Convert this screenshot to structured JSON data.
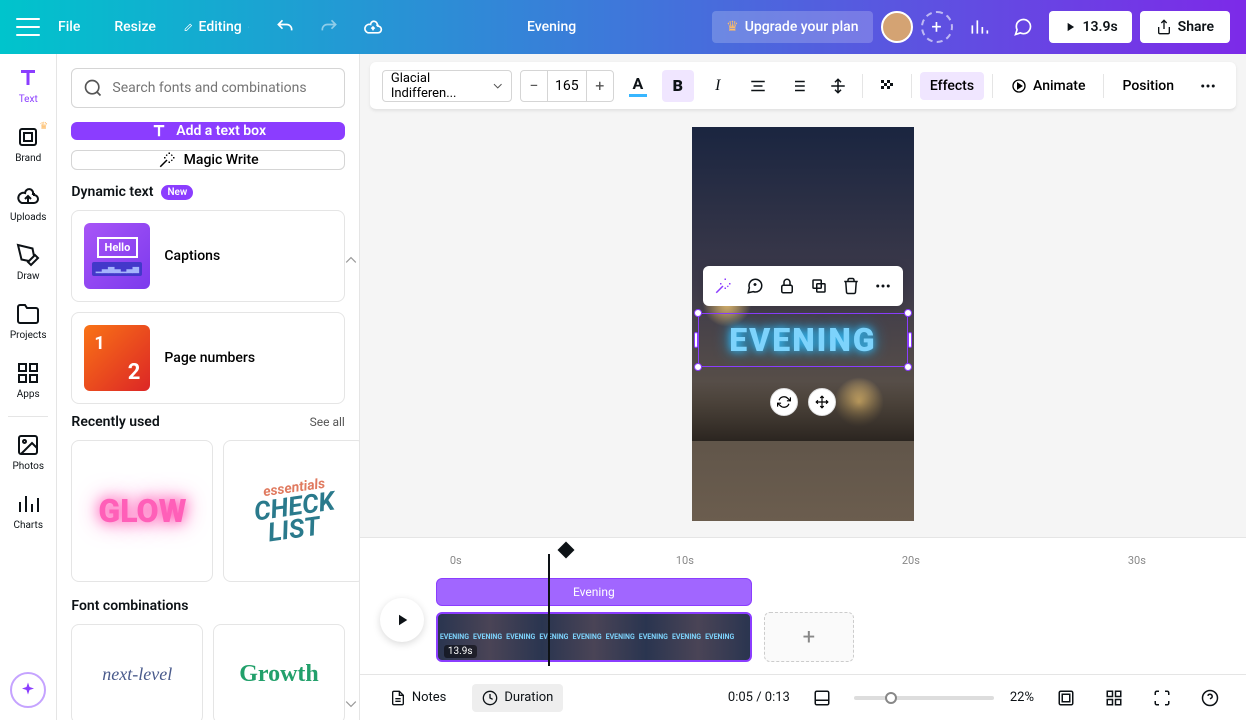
{
  "topbar": {
    "file": "File",
    "resize": "Resize",
    "editing": "Editing",
    "doc_title": "Evening",
    "upgrade": "Upgrade your plan",
    "play_time": "13.9s",
    "share": "Share"
  },
  "rail": {
    "text": "Text",
    "brand": "Brand",
    "uploads": "Uploads",
    "draw": "Draw",
    "projects": "Projects",
    "apps": "Apps",
    "photos": "Photos",
    "charts": "Charts"
  },
  "panel": {
    "search_placeholder": "Search fonts and combinations",
    "add_text": "Add a text box",
    "magic_write": "Magic Write",
    "dynamic_text": "Dynamic text",
    "new_badge": "New",
    "captions": "Captions",
    "captions_hello": "Hello",
    "page_numbers": "Page numbers",
    "recently_used": "Recently used",
    "see_all": "See all",
    "glow": "GLOW",
    "essentials": "essentials",
    "check": "CHECK",
    "list": "LIST",
    "font_combinations": "Font combinations",
    "nextlevel": "next-level",
    "growth": "Growth"
  },
  "ctx": {
    "font": "Glacial Indifferen...",
    "size": "165",
    "effects": "Effects",
    "animate": "Animate",
    "position": "Position"
  },
  "canvas": {
    "main_text": "EVENING"
  },
  "timeline": {
    "marks": [
      "0s",
      "10s",
      "20s",
      "30s"
    ],
    "audio_label": "Evening",
    "thumb_label": "EVENING",
    "clip_duration": "13.9s"
  },
  "bottom": {
    "notes": "Notes",
    "duration": "Duration",
    "time": "0:05 / 0:13",
    "zoom": "22%"
  }
}
